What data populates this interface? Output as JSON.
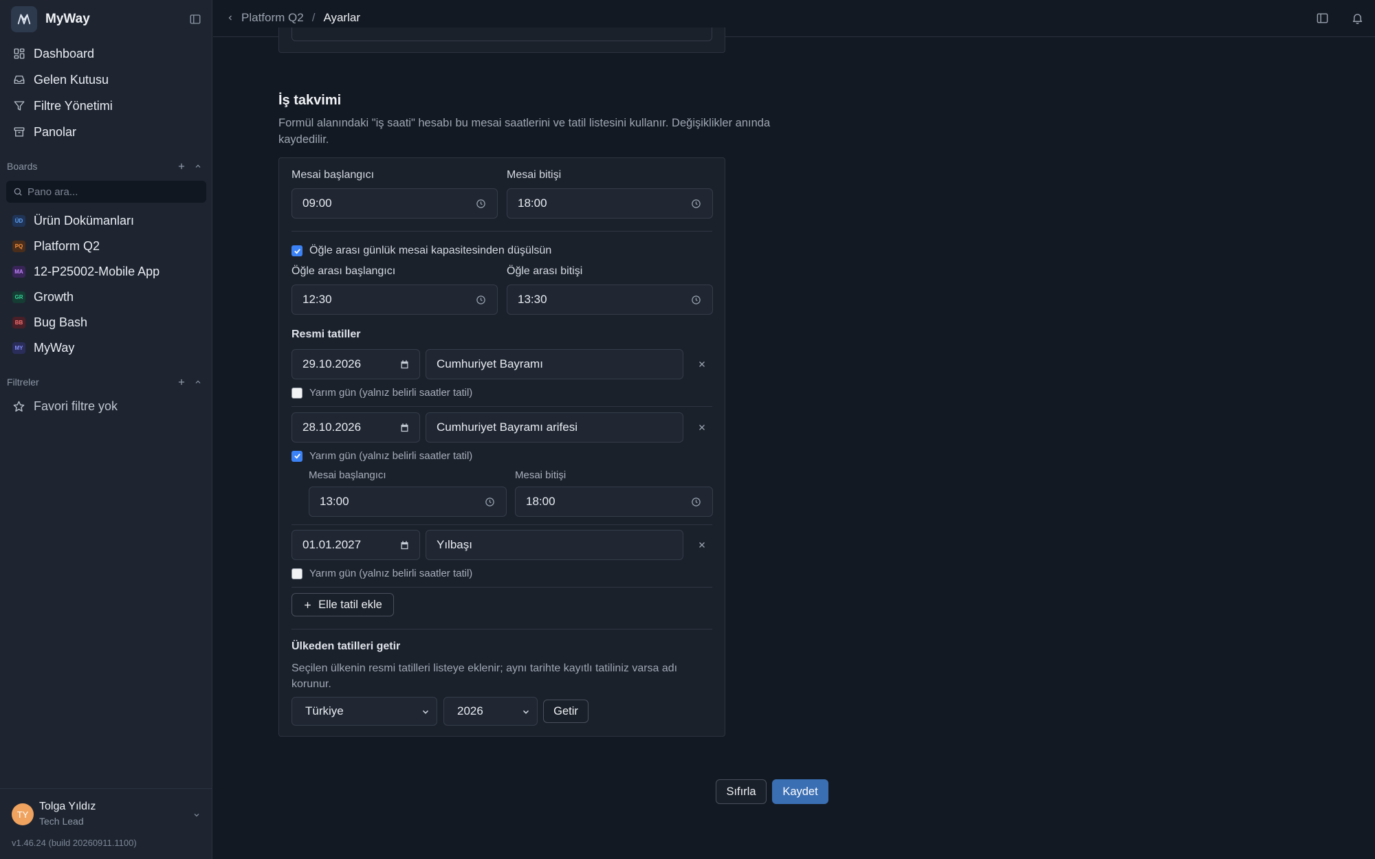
{
  "sidebar": {
    "brand": "MyWay",
    "nav": [
      {
        "label": "Dashboard",
        "icon": "grid-icon"
      },
      {
        "label": "Gelen Kutusu",
        "icon": "inbox-icon"
      },
      {
        "label": "Filtre Yönetimi",
        "icon": "filter-icon"
      },
      {
        "label": "Panolar",
        "icon": "archive-icon"
      }
    ],
    "boards_header": "Boards",
    "board_search_placeholder": "Pano ara...",
    "boards": [
      {
        "badge": "ÜD",
        "label": "Ürün Dokümanları",
        "color": "#3b82f6"
      },
      {
        "badge": "PQ",
        "label": "Platform Q2",
        "color": "#f97316"
      },
      {
        "badge": "MA",
        "label": "12-P25002-Mobile App",
        "color": "#a855f7"
      },
      {
        "badge": "GR",
        "label": "Growth",
        "color": "#10b981"
      },
      {
        "badge": "BB",
        "label": "Bug Bash",
        "color": "#ef4444"
      },
      {
        "badge": "MY",
        "label": "MyWay",
        "color": "#6366f1"
      }
    ],
    "filters_header": "Filtreler",
    "favorites_empty": "Favori filtre yok",
    "user": {
      "initials": "TY",
      "name": "Tolga Yıldız",
      "role": "Tech Lead"
    },
    "version": "v1.46.24 (build 20260911.1100)"
  },
  "topbar": {
    "breadcrumb_parent": "Platform Q2",
    "breadcrumb_sep": "/",
    "breadcrumb_current": "Ayarlar"
  },
  "work_calendar": {
    "title": "İş takvimi",
    "description": "Formül alanındaki \"iş saati\" hesabı bu mesai saatlerini ve tatil listesini kullanır. Değişiklikler anında kaydedilir.",
    "work_start_label": "Mesai başlangıcı",
    "work_start": "09:00",
    "work_end_label": "Mesai bitişi",
    "work_end": "18:00",
    "lunch_deduct_label": "Öğle arası günlük mesai kapasitesinden düşülsün",
    "lunch_start_label": "Öğle arası başlangıcı",
    "lunch_start": "12:30",
    "lunch_end_label": "Öğle arası bitişi",
    "lunch_end": "13:30",
    "holidays_label": "Resmi tatiller",
    "half_day_label": "Yarım gün (yalnız belirli saatler tatil)",
    "holidays": [
      {
        "date": "29.10.2026",
        "name": "Cumhuriyet Bayramı",
        "half_day": false
      },
      {
        "date": "28.10.2026",
        "name": "Cumhuriyet Bayramı arifesi",
        "half_day": true,
        "half_start_label": "Mesai başlangıcı",
        "half_start": "13:00",
        "half_end_label": "Mesai bitişi",
        "half_end": "18:00"
      },
      {
        "date": "01.01.2027",
        "name": "Yılbaşı",
        "half_day": false
      }
    ],
    "add_holiday_label": "Elle tatil ekle",
    "country_title": "Ülkeden tatilleri getir",
    "country_desc": "Seçilen ülkenin resmi tatilleri listeye eklenir; aynı tarihte kayıtlı tatiliniz varsa adı korunur.",
    "country": "Türkiye",
    "year": "2026",
    "fetch_label": "Getir"
  },
  "actions": {
    "reset_label": "Sıfırla",
    "save_label": "Kaydet"
  },
  "colors": {
    "accent": "#3b82f6",
    "primary_button": "#3b6fb3"
  }
}
